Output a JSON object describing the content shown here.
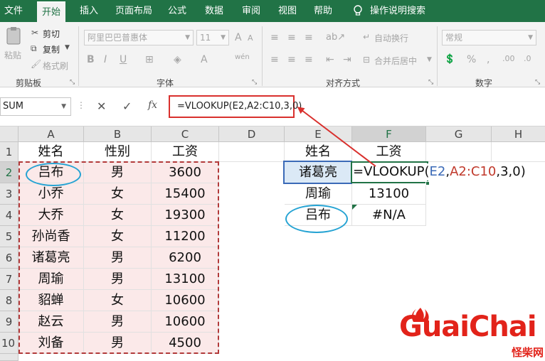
{
  "ribbon_tabs": [
    "文件",
    "开始",
    "插入",
    "页面布局",
    "公式",
    "数据",
    "审阅",
    "视图",
    "帮助",
    "操作说明搜索"
  ],
  "active_tab": "开始",
  "clipboard": {
    "paste": "粘贴",
    "cut": "剪切",
    "copy": "复制",
    "format_painter": "格式刷",
    "group": "剪贴板"
  },
  "font": {
    "name": "阿里巴巴普惠体",
    "size": "11",
    "bold": "B",
    "italic": "I",
    "underline": "U",
    "group": "字体"
  },
  "alignment": {
    "wrap": "自动换行",
    "merge": "合并后居中",
    "group": "对齐方式"
  },
  "number": {
    "format": "常规",
    "group": "数字"
  },
  "name_box": "SUM",
  "formula_text": "=VLOOKUP(E2,A2:C10,3,0)",
  "columns": [
    "A",
    "B",
    "C",
    "D",
    "E",
    "F",
    "G",
    "H"
  ],
  "rows": [
    "1",
    "2",
    "3",
    "4",
    "5",
    "6",
    "7",
    "8",
    "9",
    "10"
  ],
  "table_headers": [
    "姓名",
    "性别",
    "工资"
  ],
  "table_rows": [
    [
      "吕布",
      "男",
      "3600"
    ],
    [
      "小乔",
      "女",
      "15400"
    ],
    [
      "大乔",
      "女",
      "19300"
    ],
    [
      "孙尚香",
      "女",
      "11200"
    ],
    [
      "诸葛亮",
      "男",
      "6200"
    ],
    [
      "周瑜",
      "男",
      "13100"
    ],
    [
      "貂蝉",
      "女",
      "10600"
    ],
    [
      "赵云",
      "男",
      "10600"
    ],
    [
      "刘备",
      "男",
      "4500"
    ]
  ],
  "lookup_headers": [
    "姓名",
    "工资"
  ],
  "lookup_rows": [
    [
      "诸葛亮",
      ""
    ],
    [
      "周瑜",
      "13100"
    ],
    [
      "吕布",
      "#N/A"
    ]
  ],
  "edit": {
    "prefix": "=VLOOKUP(",
    "ref1": "E2",
    "comma1": ",",
    "ref2": "A2:C10",
    "suffix": ",3,0)"
  },
  "watermark": {
    "brand": "GuaiChai",
    "sub": "怪柴网"
  },
  "colors": {
    "excel_green": "#217346",
    "highlight_red": "#d9302d",
    "oval_blue": "#25a3d3",
    "range_pink": "#fbe9e9",
    "lookup_blue": "#dbe9f6"
  }
}
